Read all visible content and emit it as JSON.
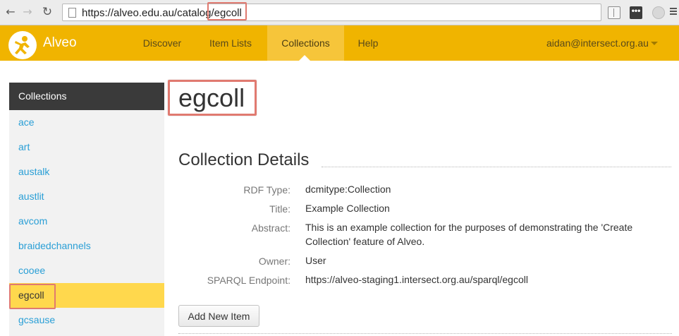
{
  "browser": {
    "url_prefix": "https://alveo.edu.au/catalog/",
    "url_highlight": "egcoll",
    "ext_dots": "•••"
  },
  "navbar": {
    "brand": "Alveo",
    "items": [
      "Discover",
      "Item Lists",
      "Collections",
      "Help"
    ],
    "active": "Collections",
    "user": "aidan@intersect.org.au"
  },
  "sidebar": {
    "heading": "Collections",
    "items": [
      "ace",
      "art",
      "austalk",
      "austlit",
      "avcom",
      "braidedchannels",
      "cooee",
      "egcoll",
      "gcsause"
    ],
    "active": "egcoll"
  },
  "main": {
    "title": "egcoll",
    "section_title": "Collection Details",
    "details": [
      {
        "label": "RDF Type:",
        "value": "dcmitype:Collection"
      },
      {
        "label": "Title:",
        "value": "Example Collection"
      },
      {
        "label": "Abstract:",
        "value_line1": "This is an example collection for the purposes of demonstrating the 'Create",
        "value_line2": "Collection' feature of Alveo."
      },
      {
        "label": "Owner:",
        "value": "User"
      },
      {
        "label": "SPARQL Endpoint:",
        "value": "https://alveo-staging1.intersect.org.au/sparql/egcoll"
      }
    ],
    "add_button": "Add New Item"
  },
  "colors": {
    "navbar": "#f0b400",
    "active_sidebar": "#ffd84d",
    "link": "#2a9fd6",
    "highlight_box": "#e07a70"
  }
}
